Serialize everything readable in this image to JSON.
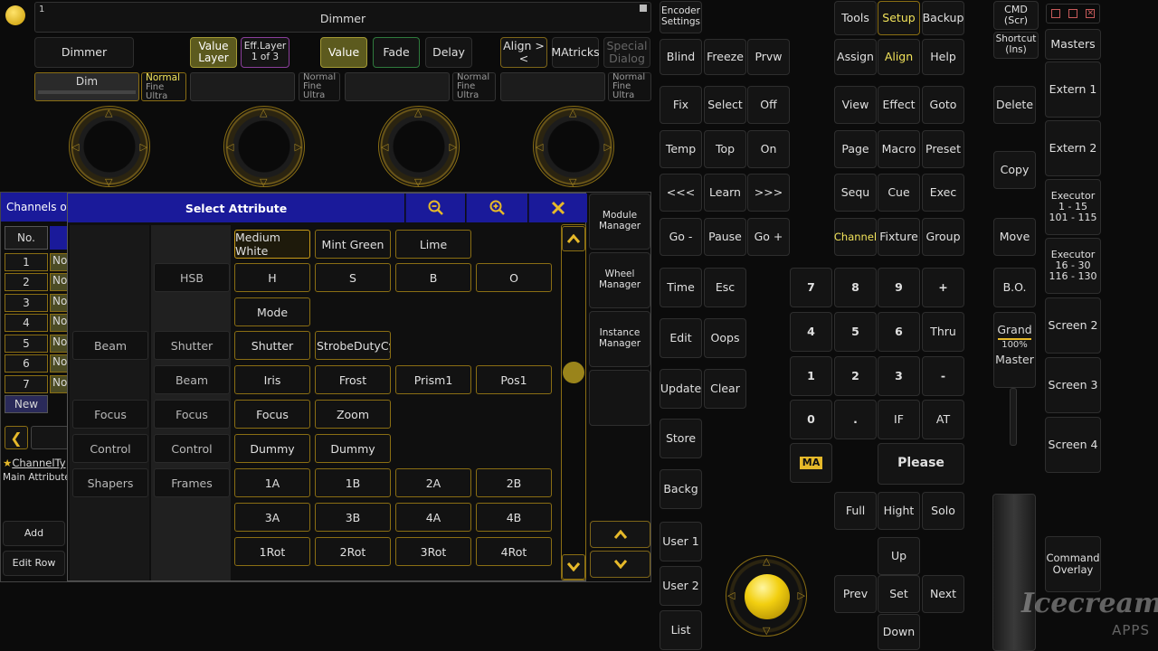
{
  "top": {
    "window_number": "1",
    "title": "Dimmer",
    "attr_buttons": [
      "Dimmer",
      "Value Layer",
      "Eff.Layer 1 of 3",
      "Value",
      "Fade",
      "Delay",
      "Align ><",
      "MAtricks",
      "Special Dialog"
    ],
    "encoder_fields": [
      "Dim",
      "",
      "",
      ""
    ],
    "resolution_label": [
      "Normal",
      "Fine",
      "Ultra"
    ]
  },
  "channels_title": "Channels of",
  "dialog": {
    "title": "Select Attribute",
    "zoom_out_icon": "zoom-out-icon",
    "zoom_in_icon": "zoom-in-icon",
    "close_icon": "close-icon",
    "col1": [
      "Beam",
      "Focus",
      "Control",
      "Shapers"
    ],
    "col2": [
      "HSB",
      "Shutter",
      "Beam",
      "Focus",
      "Control",
      "Frames"
    ],
    "grid": {
      "r0": [
        "Medium White",
        "Mint Green",
        "Lime"
      ],
      "r1": [
        "H",
        "S",
        "B",
        "O"
      ],
      "r2": [
        "Mode"
      ],
      "r3": [
        "Shutter",
        "StrobeDutyCyc"
      ],
      "r4": [
        "Iris",
        "Frost",
        "Prism1",
        "Pos1"
      ],
      "r5": [
        "Focus",
        "Zoom"
      ],
      "r6": [
        "Dummy",
        "Dummy"
      ],
      "r7": [
        "1A",
        "1B",
        "2A",
        "2B"
      ],
      "r8": [
        "3A",
        "3B",
        "4A",
        "4B"
      ],
      "r9": [
        "1Rot",
        "2Rot",
        "3Rot",
        "4Rot"
      ]
    },
    "side": [
      "Module Manager",
      "Wheel Manager",
      "Instance Manager"
    ]
  },
  "table": {
    "header": "No.",
    "rows": [
      "1",
      "2",
      "3",
      "4",
      "5",
      "6",
      "7"
    ],
    "row_text": "Nor",
    "new": "New",
    "channel_type": "ChannelTy",
    "main_attr": "Main Attribute",
    "add": "Add",
    "edit_row": "Edit Row"
  },
  "mid": {
    "col1": [
      "Encoder Settings",
      "Blind",
      "Fix",
      "Temp",
      "<<<",
      "Go -",
      "Time",
      "Edit",
      "Update",
      "Store",
      "Backg",
      "User 1",
      "User 2",
      "List"
    ],
    "col2": [
      "Freeze",
      "Select",
      "Top",
      "Learn",
      "Pause",
      "Esc",
      "Oops",
      "Clear"
    ],
    "col3": [
      "Prvw",
      "Off",
      "On",
      ">>>",
      "Go +"
    ]
  },
  "right": {
    "row0": [
      "Tools",
      "Setup",
      "Backup"
    ],
    "row1": [
      "Assign",
      "Align",
      "Help"
    ],
    "row2": [
      "View",
      "Effect",
      "Goto"
    ],
    "row3": [
      "Page",
      "Macro",
      "Preset"
    ],
    "row4": [
      "Sequ",
      "Cue",
      "Exec"
    ],
    "row5": [
      "Channel",
      "Fixture",
      "Group"
    ],
    "keypad": [
      "7",
      "8",
      "9",
      "+",
      "4",
      "5",
      "6",
      "Thru",
      "1",
      "2",
      "3",
      "-",
      "0",
      ".",
      "IF",
      "AT"
    ],
    "please": "Please",
    "logo": "MA",
    "bottom": [
      "Full",
      "Hight",
      "Solo"
    ],
    "nav": [
      "Up",
      "Prev",
      "Set",
      "Next",
      "Down"
    ]
  },
  "far": {
    "cmd": "CMD (Scr)",
    "shortcut": "Shortcut (Ins)",
    "delete": "Delete",
    "copy": "Copy",
    "move": "Move",
    "bo": "B.O.",
    "grand": "Grand",
    "grand_value": "100%",
    "master": "Master",
    "views": [
      "Masters",
      "Extern 1",
      "Extern 2",
      "Executor 1 - 15 101 - 115",
      "Executor 16 - 30 116 - 130",
      "Screen 2",
      "Screen 3",
      "Screen 4",
      "Command Overlay"
    ]
  },
  "watermark": {
    "line1": "Icecream",
    "line2": "APPS"
  }
}
